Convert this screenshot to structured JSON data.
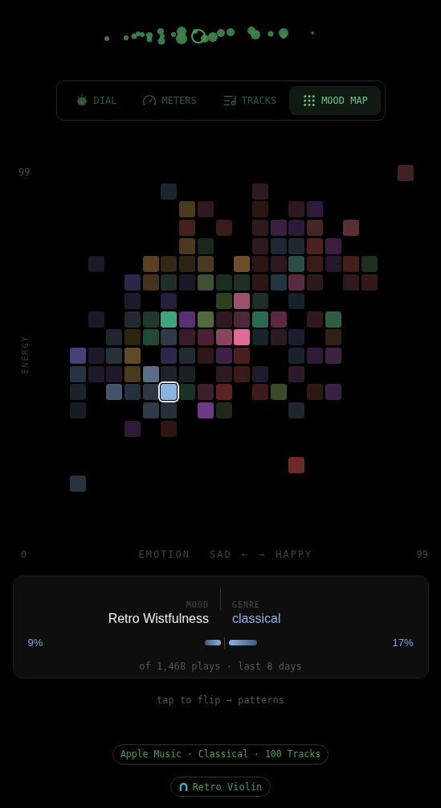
{
  "tabs": [
    {
      "label": "DIAL",
      "kind": "dial",
      "selected": false
    },
    {
      "label": "METERS",
      "kind": "meters",
      "selected": false
    },
    {
      "label": "TRACKS",
      "kind": "tracks",
      "selected": false
    },
    {
      "label": "MOOD MAP",
      "kind": "grid",
      "selected": true
    }
  ],
  "map": {
    "y_max": "99",
    "y_label": "ENERGY",
    "x_min": "0",
    "x_max": "99",
    "x_label": "EMOTION",
    "x_left": "SAD",
    "x_left_arrow": "←",
    "x_right_arrow": "→",
    "x_right": "HAPPY",
    "rows": [
      [
        null,
        null,
        null,
        null,
        null,
        null,
        null,
        null,
        null,
        null,
        null,
        null,
        null,
        null,
        null,
        null,
        null,
        null,
        {
          "color": "#3f2226",
          "selected": false
        }
      ],
      [
        null,
        null,
        null,
        null,
        null,
        {
          "color": "#1e2530",
          "selected": false
        },
        null,
        null,
        null,
        null,
        {
          "color": "#2e1a20",
          "selected": false
        },
        null,
        null,
        null,
        null,
        null,
        null,
        null,
        null
      ],
      [
        null,
        null,
        null,
        null,
        null,
        null,
        {
          "color": "#4a3a1e",
          "selected": false
        },
        {
          "color": "#2e1a20",
          "selected": false
        },
        null,
        null,
        {
          "color": "#2c1614",
          "selected": false
        },
        null,
        {
          "color": "#2e1a1c",
          "selected": false
        },
        {
          "color": "#2e1a3c",
          "selected": false
        },
        null,
        null,
        null,
        null,
        null
      ],
      [
        null,
        null,
        null,
        null,
        null,
        null,
        {
          "color": "#44201e",
          "selected": false
        },
        null,
        {
          "color": "#3a1a18",
          "selected": false
        },
        null,
        {
          "color": "#2e1a1e",
          "selected": false
        },
        {
          "color": "#3a1e44",
          "selected": false
        },
        {
          "color": "#2c1a36",
          "selected": false
        },
        {
          "color": "#462428",
          "selected": false
        },
        null,
        {
          "color": "#5a2e38",
          "selected": false
        },
        null,
        null,
        null
      ],
      [
        null,
        null,
        null,
        null,
        null,
        null,
        {
          "color": "#4a3820",
          "selected": false
        },
        {
          "color": "#1a2818",
          "selected": false
        },
        null,
        null,
        {
          "color": "#2e1a1e",
          "selected": false
        },
        {
          "color": "#1e2832",
          "selected": false
        },
        {
          "color": "#1e2830",
          "selected": false
        },
        {
          "color": "#4e2020",
          "selected": false
        },
        {
          "color": "#3a1e40",
          "selected": false
        },
        null,
        null,
        null,
        null
      ],
      [
        null,
        {
          "color": "#1c1a2a",
          "selected": false
        },
        null,
        null,
        {
          "color": "#5a4020",
          "selected": false
        },
        {
          "color": "#322816",
          "selected": false
        },
        {
          "color": "#2e2414",
          "selected": false
        },
        {
          "color": "#4a3a20",
          "selected": false
        },
        null,
        {
          "color": "#6e4e2a",
          "selected": false
        },
        {
          "color": "#2c1614",
          "selected": false
        },
        {
          "color": "#2e1a1e",
          "selected": false
        },
        {
          "color": "#2a4e48",
          "selected": false
        },
        {
          "color": "#3a1a18",
          "selected": false
        },
        {
          "color": "#24182a",
          "selected": false
        },
        {
          "color": "#441e1a",
          "selected": false
        },
        {
          "color": "#1e2e22",
          "selected": false
        },
        null,
        null
      ],
      [
        null,
        null,
        null,
        {
          "color": "#2a2848",
          "selected": false
        },
        {
          "color": "#44321c",
          "selected": false
        },
        {
          "color": "#1e3026",
          "selected": false
        },
        {
          "color": "#181a26",
          "selected": false
        },
        {
          "color": "#3e5230",
          "selected": false
        },
        {
          "color": "#182e22",
          "selected": false
        },
        {
          "color": "#1e3024",
          "selected": false
        },
        {
          "color": "#2e1614",
          "selected": false
        },
        {
          "color": "#223642",
          "selected": false
        },
        {
          "color": "#5a2a42",
          "selected": false
        },
        {
          "color": "#2a1a1a",
          "selected": false
        },
        null,
        {
          "color": "#2e1a1c",
          "selected": false
        },
        {
          "color": "#361818",
          "selected": false
        },
        null,
        null
      ],
      [
        null,
        null,
        null,
        {
          "color": "#1e1a28",
          "selected": false
        },
        null,
        {
          "color": "#22203c",
          "selected": false
        },
        null,
        null,
        {
          "color": "#2e3e22",
          "selected": false
        },
        {
          "color": "#a04e6e",
          "selected": false
        },
        {
          "color": "#1e3026",
          "selected": false
        },
        null,
        {
          "color": "#18202a",
          "selected": false
        },
        null,
        null,
        null,
        null,
        null,
        null
      ],
      [
        null,
        {
          "color": "#1c1a2a",
          "selected": false
        },
        null,
        {
          "color": "#22282e",
          "selected": false
        },
        {
          "color": "#1e3a2a",
          "selected": false
        },
        {
          "color": "#3ea47a",
          "selected": false
        },
        {
          "color": "#5a2e74",
          "selected": false
        },
        {
          "color": "#526a3a",
          "selected": false
        },
        {
          "color": "#2e1a20",
          "selected": false
        },
        {
          "color": "#4a2838",
          "selected": false
        },
        {
          "color": "#2a6a4e",
          "selected": false
        },
        {
          "color": "#5a2840",
          "selected": false
        },
        null,
        {
          "color": "#2e1a1c",
          "selected": false
        },
        {
          "color": "#2e5e42",
          "selected": false
        },
        null,
        null,
        null,
        null
      ],
      [
        null,
        null,
        {
          "color": "#20262e",
          "selected": false
        },
        {
          "color": "#2e2414",
          "selected": false
        },
        {
          "color": "#1e4a36",
          "selected": false
        },
        {
          "color": "#2e3a48",
          "selected": false
        },
        {
          "color": "#3a1c28",
          "selected": false
        },
        {
          "color": "#4a2034",
          "selected": false
        },
        {
          "color": "#8a4460",
          "selected": false
        },
        {
          "color": "#e06a98",
          "selected": false
        },
        {
          "color": "#1a222a",
          "selected": false
        },
        {
          "color": "#2e1a22",
          "selected": false
        },
        {
          "color": "#1a1e2e",
          "selected": false
        },
        null,
        {
          "color": "#2e2214",
          "selected": false
        },
        null,
        null,
        null,
        null
      ],
      [
        {
          "color": "#48407a",
          "selected": false
        },
        {
          "color": "#1c1a2a",
          "selected": false
        },
        {
          "color": "#283038",
          "selected": false
        },
        {
          "color": "#604a26",
          "selected": false
        },
        null,
        {
          "color": "#2a2848",
          "selected": false
        },
        {
          "color": "#222a32",
          "selected": false
        },
        {
          "color": "#2e1816",
          "selected": false
        },
        {
          "color": "#3e2048",
          "selected": false
        },
        {
          "color": "#4a1e1e",
          "selected": false
        },
        null,
        null,
        {
          "color": "#18222a",
          "selected": false
        },
        {
          "color": "#301a36",
          "selected": false
        },
        {
          "color": "#3e2244",
          "selected": false
        },
        null,
        null,
        null,
        null
      ],
      [
        {
          "color": "#263440",
          "selected": false
        },
        {
          "color": "#1e1a2c",
          "selected": false
        },
        {
          "color": "#22182a",
          "selected": false
        },
        {
          "color": "#4a3a1e",
          "selected": false
        },
        {
          "color": "#5a6e88",
          "selected": false
        },
        {
          "color": "#1e232a",
          "selected": false
        },
        {
          "color": "#182024",
          "selected": false
        },
        null,
        {
          "color": "#2e1a1e",
          "selected": false
        },
        {
          "color": "#3a1a1a",
          "selected": false
        },
        {
          "color": "#1c1c2a",
          "selected": false
        },
        null,
        {
          "color": "#2a1a2c",
          "selected": false
        },
        null,
        null,
        null,
        null,
        null,
        null
      ],
      [
        {
          "color": "#1c2228",
          "selected": false
        },
        null,
        {
          "color": "#44546a",
          "selected": false
        },
        {
          "color": "#243240",
          "selected": false
        },
        {
          "color": "#2e3642",
          "selected": false
        },
        {
          "color": "#8ab4e0",
          "selected": true
        },
        {
          "color": "#1a3222",
          "selected": false
        },
        {
          "color": "#3e1e2a",
          "selected": false
        },
        {
          "color": "#5a2222",
          "selected": false
        },
        null,
        {
          "color": "#3e1a1a",
          "selected": false
        },
        {
          "color": "#3a4a28",
          "selected": false
        },
        null,
        {
          "color": "#2e1816",
          "selected": false
        },
        {
          "color": "#3a2044",
          "selected": false
        },
        null,
        null,
        null,
        null
      ],
      [
        {
          "color": "#161c22",
          "selected": false
        },
        null,
        null,
        null,
        {
          "color": "#2e3a48",
          "selected": false
        },
        {
          "color": "#26303a",
          "selected": false
        },
        null,
        {
          "color": "#6e3a88",
          "selected": false
        },
        {
          "color": "#20281a",
          "selected": false
        },
        null,
        null,
        null,
        {
          "color": "#20262e",
          "selected": false
        },
        null,
        null,
        null,
        null,
        null,
        null
      ],
      [
        null,
        null,
        null,
        {
          "color": "#2e1a36",
          "selected": false
        },
        null,
        {
          "color": "#2e1616",
          "selected": false
        },
        null,
        null,
        null,
        null,
        null,
        null,
        null,
        null,
        null,
        null,
        null,
        null,
        null
      ],
      [
        null,
        null,
        null,
        null,
        null,
        null,
        null,
        null,
        null,
        null,
        null,
        null,
        null,
        null,
        null,
        null,
        null,
        null,
        null
      ],
      [
        null,
        null,
        null,
        null,
        null,
        null,
        null,
        null,
        null,
        null,
        null,
        null,
        {
          "color": "#6e2a28",
          "selected": false
        },
        null,
        null,
        null,
        null,
        null,
        null
      ],
      [
        {
          "color": "#263442",
          "selected": false
        },
        null,
        null,
        null,
        null,
        null,
        null,
        null,
        null,
        null,
        null,
        null,
        null,
        null,
        null,
        null,
        null,
        null,
        null
      ]
    ]
  },
  "card": {
    "mood_label": "MOOD",
    "mood": "Retro Wistfulness",
    "genre_label": "GENRE",
    "genre": "classical",
    "mood_share": "9%",
    "genre_share": "17%",
    "footnote": "of 1,468 plays · last 8 days"
  },
  "hint": "tap to flip → patterns",
  "source_pill": "Apple Music · Classical · 100 Tracks",
  "playlist_pill": "Retro Violin"
}
